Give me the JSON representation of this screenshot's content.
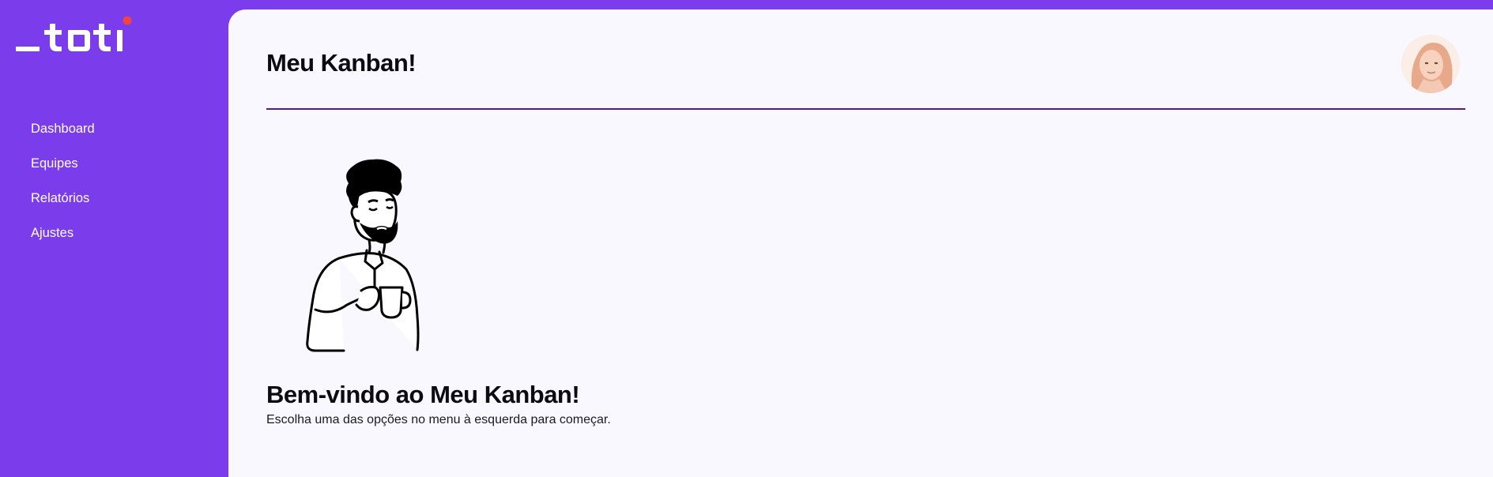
{
  "brand": {
    "logo_text": "_toti",
    "colors": {
      "primary": "#7b3cec",
      "accent_dot": "#ef4444",
      "panel_bg": "#faf8ff",
      "divider": "#4c1d95"
    }
  },
  "sidebar": {
    "items": [
      {
        "label": "Dashboard"
      },
      {
        "label": "Equipes"
      },
      {
        "label": "Relatórios"
      },
      {
        "label": "Ajustes"
      }
    ]
  },
  "header": {
    "title": "Meu Kanban!",
    "avatar_icon": "user-avatar"
  },
  "welcome": {
    "illustration_icon": "man-drinking-coffee-illustration",
    "title": "Bem-vindo ao Meu Kanban!",
    "subtitle": "Escolha uma das opções no menu à esquerda para começar."
  }
}
